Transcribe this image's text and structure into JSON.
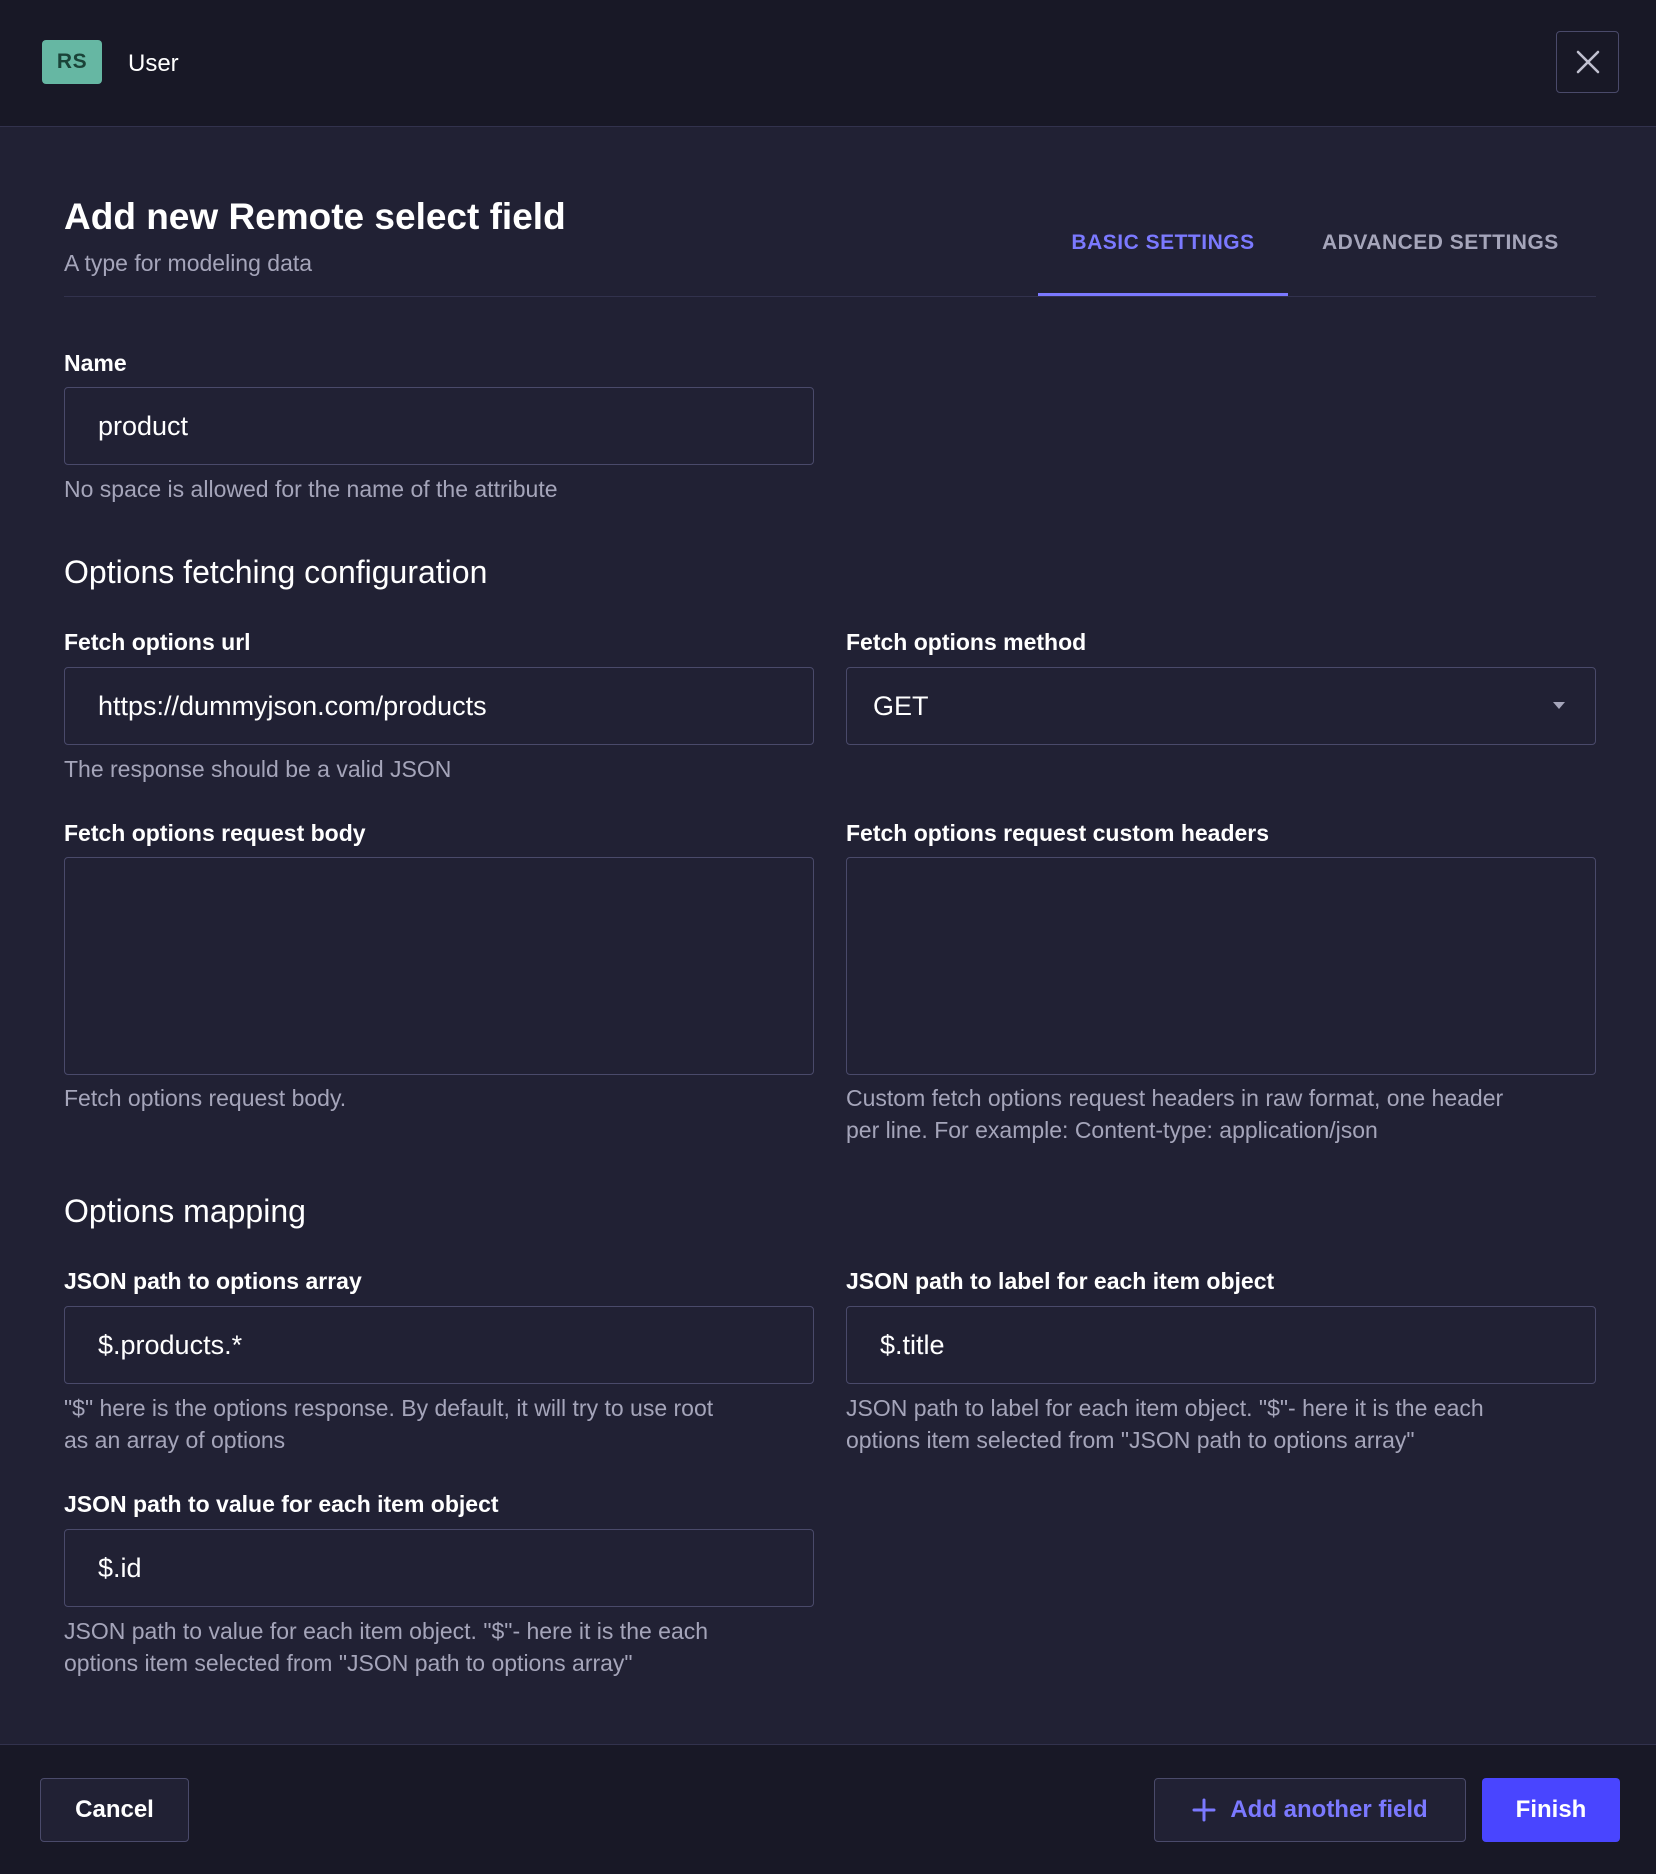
{
  "header": {
    "badge": "RS",
    "title": "User",
    "close_icon": "close-icon"
  },
  "page": {
    "title": "Add new Remote select field",
    "subtitle": "A type for modeling data",
    "tabs": [
      {
        "label": "BASIC SETTINGS",
        "active": true
      },
      {
        "label": "ADVANCED SETTINGS",
        "active": false
      }
    ]
  },
  "name_field": {
    "label": "Name",
    "value": "product",
    "hint": "No space is allowed for the name of the attribute"
  },
  "fetching": {
    "section_title": "Options fetching configuration",
    "url": {
      "label": "Fetch options url",
      "value": "https://dummyjson.com/products",
      "hint": "The response should be a valid JSON"
    },
    "method": {
      "label": "Fetch options method",
      "value": "GET"
    },
    "body": {
      "label": "Fetch options request body",
      "value": "",
      "hint": "Fetch options request body."
    },
    "headers": {
      "label": "Fetch options request custom headers",
      "value": "",
      "hint_line1": "Custom fetch options request headers in raw format, one header",
      "hint_line2": "per line. For example: Content-type: application/json"
    }
  },
  "mapping": {
    "section_title": "Options mapping",
    "array_path": {
      "label": "JSON path to options array",
      "value": "$.products.*",
      "hint_line1": "\"$\" here is the options response. By default, it will try to use root",
      "hint_line2": "as an array of options"
    },
    "label_path": {
      "label": "JSON path to label for each item object",
      "value": "$.title",
      "hint_line1": "JSON path to label for each item object. \"$\"- here it is the each",
      "hint_line2": "options item selected from \"JSON path to options array\""
    },
    "value_path": {
      "label": "JSON path to value for each item object",
      "value": "$.id",
      "hint_line1": "JSON path to value for each item object. \"$\"- here it is the each",
      "hint_line2": "options item selected from \"JSON path to options array\""
    }
  },
  "footer": {
    "cancel": "Cancel",
    "add_another": "Add another field",
    "finish": "Finish"
  },
  "colors": {
    "background": "#212134",
    "header_bg": "#181826",
    "accent": "#7b79ff",
    "primary_button": "#4945ff",
    "badge_bg": "#66b7a3"
  }
}
